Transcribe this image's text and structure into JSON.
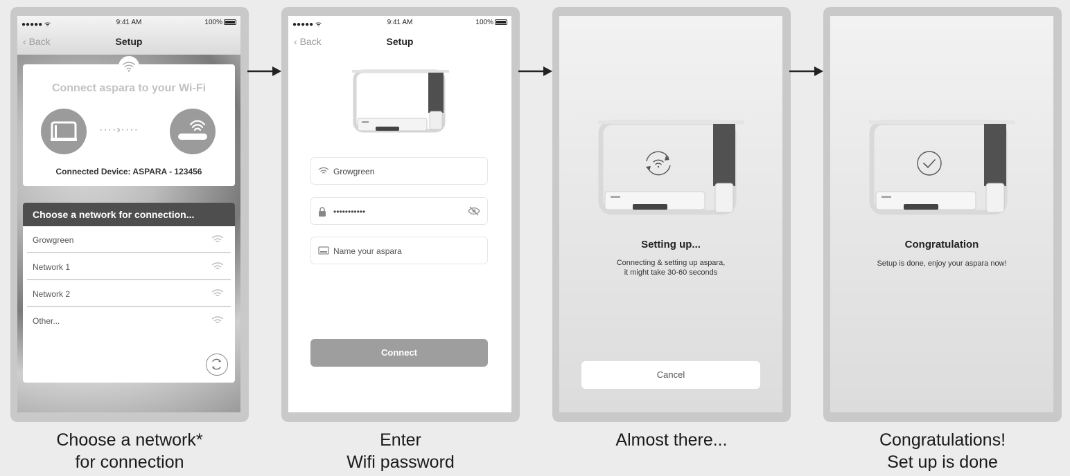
{
  "status": {
    "signal": "●●●●● ᯤ",
    "time": "9:41 AM",
    "battery": "100%"
  },
  "nav": {
    "back": "Back",
    "title": "Setup"
  },
  "screen1": {
    "card_title": "Connect aspara to your Wi-Fi",
    "connected_device": "Connected Device: ASPARA - 123456",
    "list_header": "Choose a network for connection...",
    "networks": [
      "Growgreen",
      "Network 1",
      "Network 2",
      "Other..."
    ]
  },
  "screen2": {
    "wifi_value": "Growgreen",
    "password_value": "•••••••••••",
    "name_placeholder": "Name your aspara",
    "connect_label": "Connect"
  },
  "screen3": {
    "title": "Setting up...",
    "subtitle_line1": "Connecting & setting up aspara,",
    "subtitle_line2": "it might take 30-60 seconds",
    "cancel_label": "Cancel"
  },
  "screen4": {
    "title": "Congratulation",
    "subtitle": "Setup is done, enjoy your aspara now!"
  },
  "captions": {
    "c1": [
      "Choose a network*",
      "for connection"
    ],
    "c2": [
      "Enter",
      "Wifi password"
    ],
    "c3": [
      "Almost there..."
    ],
    "c4": [
      "Congratulations!",
      "Set up is done"
    ]
  }
}
